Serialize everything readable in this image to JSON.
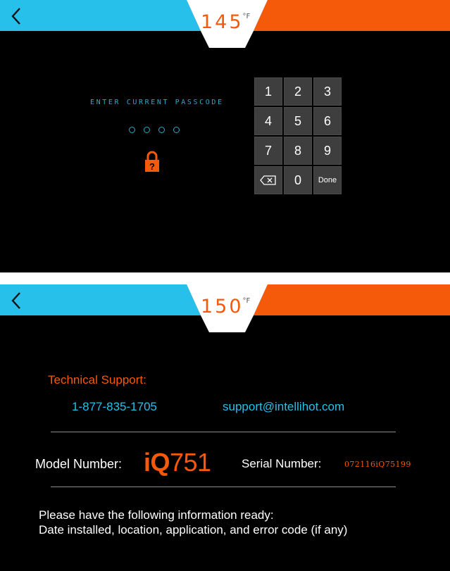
{
  "colors": {
    "accent_blue": "#27c0ea",
    "accent_orange": "#f55a0a",
    "background": "#000000",
    "key": "#3e3e3e"
  },
  "lock_screen": {
    "header": {
      "back_icon": "chevron-left-icon",
      "temperature": "145",
      "temperature_unit": "°F"
    },
    "prompt": "ENTER CURRENT PASSCODE",
    "passcode_length": 4,
    "lock_icon": "padlock-question-icon",
    "keypad": {
      "keys": [
        "1",
        "2",
        "3",
        "4",
        "5",
        "6",
        "7",
        "8",
        "9"
      ],
      "backspace_icon": "backspace-icon",
      "zero": "0",
      "done": "Done"
    }
  },
  "support_screen": {
    "header": {
      "back_icon": "chevron-left-icon",
      "temperature": "150",
      "temperature_unit": "°F"
    },
    "title": "Technical Support:",
    "phone": "1-877-835-1705",
    "email": "support@intellihot.com",
    "model_label": "Model Number:",
    "model_prefix": "iQ",
    "model_number": "751",
    "serial_label": "Serial Number:",
    "serial_value": "072116iQ75199",
    "info_line1": "Please have the following information ready:",
    "info_line2": "Date installed, location, application, and error code (if any)"
  }
}
